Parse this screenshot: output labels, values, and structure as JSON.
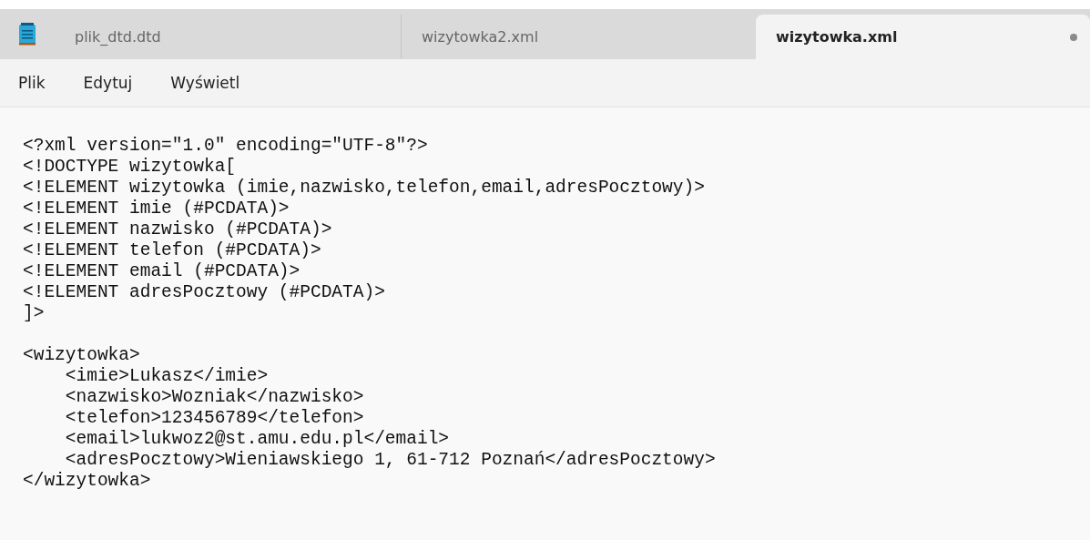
{
  "tabs": [
    {
      "label": "plik_dtd.dtd",
      "selected": false,
      "unsaved": false
    },
    {
      "label": "wizytowka2.xml",
      "selected": false,
      "unsaved": false
    },
    {
      "label": "wizytowka.xml",
      "selected": true,
      "unsaved": true
    }
  ],
  "menu": [
    "Plik",
    "Edytuj",
    "Wyświetl"
  ],
  "editor": {
    "blocks": [
      [
        "<?xml version=\"1.0\" encoding=\"UTF-8\"?>",
        "<!DOCTYPE wizytowka[",
        "<!ELEMENT wizytowka (imie,nazwisko,telefon,email,adresPocztowy)>",
        "<!ELEMENT imie (#PCDATA)>",
        "<!ELEMENT nazwisko (#PCDATA)>",
        "<!ELEMENT telefon (#PCDATA)>",
        "<!ELEMENT email (#PCDATA)>",
        "<!ELEMENT adresPocztowy (#PCDATA)>",
        "]>"
      ],
      [
        "<wizytowka>",
        "    <imie>Lukasz</imie>",
        "    <nazwisko>Wozniak</nazwisko>",
        "    <telefon>123456789</telefon>",
        "    <email>lukwoz2@st.amu.edu.pl</email>",
        "    <adresPocztowy>Wieniawskiego 1, 61-712 Poznań</adresPocztowy>",
        "</wizytowka>"
      ]
    ]
  }
}
